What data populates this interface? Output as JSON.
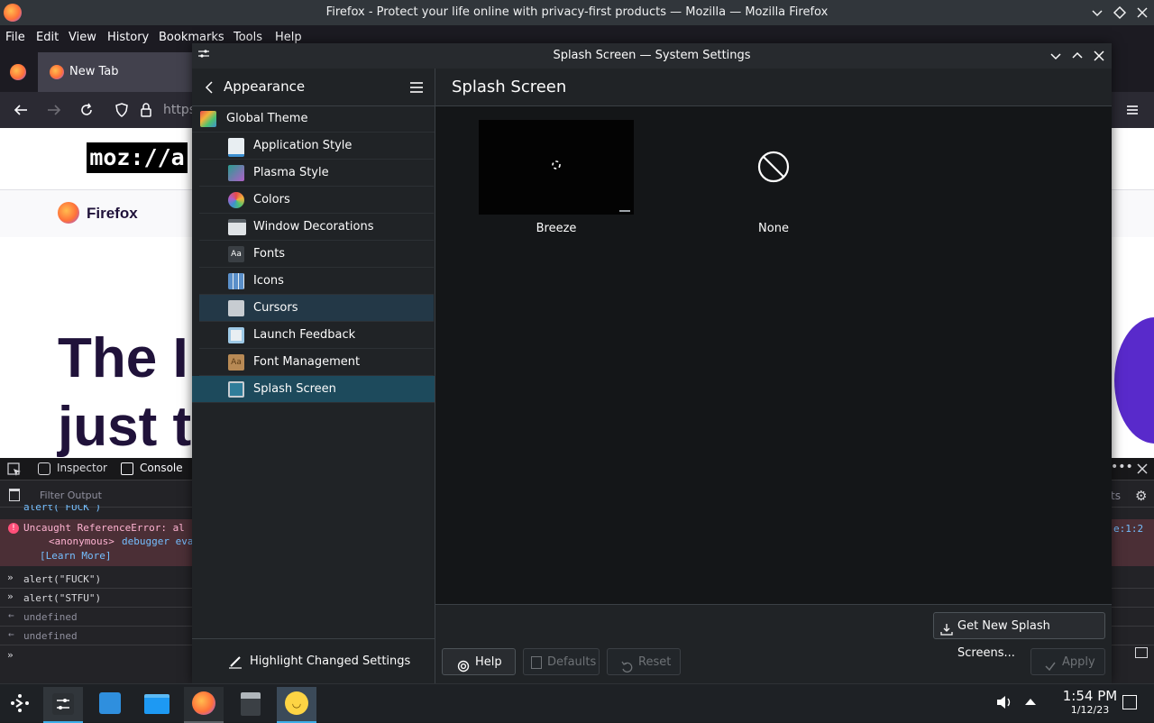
{
  "firefox": {
    "window_title": "Firefox - Protect your life online with privacy-first products — Mozilla — Mozilla Firefox",
    "menu": [
      "File",
      "Edit",
      "View",
      "History",
      "Bookmarks",
      "Tools",
      "Help"
    ],
    "tab_label": "New Tab",
    "url_partial": "https",
    "page": {
      "logo": "moz://a",
      "brand": "Firefox",
      "hero_line1": "The I",
      "hero_line2": "just t"
    },
    "devtools": {
      "tab_inspector": "Inspector",
      "tab_console": "Console",
      "filter_placeholder": "Filter Output",
      "right_partial": "ts",
      "lines": [
        "alert( FUCK )",
        "Uncaught ReferenceError: al",
        "<anonymous>",
        "debugger eva",
        "[Learn More]",
        "alert(\"FUCK\")",
        "alert(\"STFU\")",
        "undefined",
        "undefined"
      ],
      "err_location": "e:1:2"
    }
  },
  "settings": {
    "window_title": "Splash Screen — System Settings",
    "sidebar": {
      "header": "Appearance",
      "parent_item": "Global Theme",
      "items": [
        {
          "label": "Application Style",
          "color": "#3c8fd0"
        },
        {
          "label": "Plasma Style",
          "color": "#2a9d8f"
        },
        {
          "label": "Colors",
          "color": "#e8a33c"
        },
        {
          "label": "Window Decorations",
          "color": "#dfe3e6"
        },
        {
          "label": "Fonts",
          "color": "#3a3f44"
        },
        {
          "label": "Icons",
          "color": "#5a8fc9"
        },
        {
          "label": "Cursors",
          "color": "#c7ccd1"
        },
        {
          "label": "Launch Feedback",
          "color": "#9ec9e6"
        },
        {
          "label": "Font Management",
          "color": "#b88a55"
        },
        {
          "label": "Splash Screen",
          "color": "#2f7d9a"
        }
      ],
      "highlight_button": "Highlight Changed Settings"
    },
    "main": {
      "title": "Splash Screen",
      "themes": [
        {
          "label": "Breeze"
        },
        {
          "label": "None"
        }
      ],
      "get_new_button": "Get New Splash Screens...",
      "help_button": "Help",
      "defaults_button": "Defaults",
      "reset_button": "Reset",
      "apply_button": "Apply"
    }
  },
  "taskbar": {
    "time": "1:54 PM",
    "date": "1/12/23"
  }
}
